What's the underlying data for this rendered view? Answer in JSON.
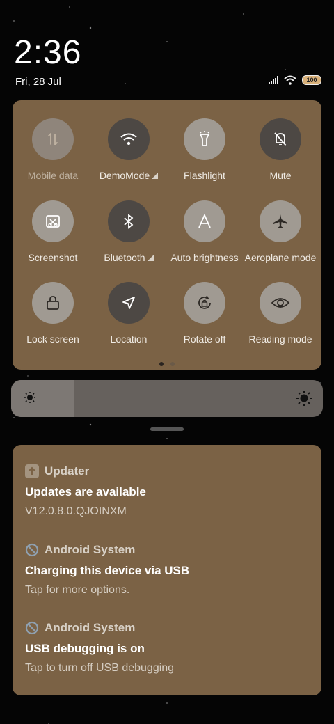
{
  "status": {
    "time": "2:36",
    "date": "Fri, 28 Jul",
    "battery": "100"
  },
  "quick_settings": {
    "tiles": [
      {
        "label": "Mobile data",
        "icon": "mobile-data-icon",
        "state": "off"
      },
      {
        "label": "DemoMode",
        "icon": "wifi-icon",
        "state": "on"
      },
      {
        "label": "Flashlight",
        "icon": "flashlight-icon",
        "state": "off"
      },
      {
        "label": "Mute",
        "icon": "mute-bell-icon",
        "state": "on"
      },
      {
        "label": "Screenshot",
        "icon": "screenshot-icon",
        "state": "off"
      },
      {
        "label": "Bluetooth",
        "icon": "bluetooth-icon",
        "state": "on"
      },
      {
        "label": "Auto brightness",
        "icon": "auto-brightness-icon",
        "state": "off"
      },
      {
        "label": "Aeroplane mode",
        "icon": "airplane-icon",
        "state": "off"
      },
      {
        "label": "Lock screen",
        "icon": "lock-icon",
        "state": "off"
      },
      {
        "label": "Location",
        "icon": "location-icon",
        "state": "on"
      },
      {
        "label": "Rotate off",
        "icon": "rotate-lock-icon",
        "state": "off"
      },
      {
        "label": "Reading mode",
        "icon": "eye-icon",
        "state": "off"
      }
    ],
    "page_count": 2,
    "current_page": 1
  },
  "brightness": {
    "level": 0.2
  },
  "notifications": [
    {
      "app": "Updater",
      "title": "Updates are available",
      "text": "V12.0.8.0.QJOINXM"
    },
    {
      "app": "Android System",
      "title": "Charging this device via USB",
      "text": "Tap for more options."
    },
    {
      "app": "Android System",
      "title": "USB debugging is on",
      "text": "Tap to turn off USB debugging"
    }
  ],
  "colors": {
    "panel": "#7b6245",
    "tile_on": "#4d4844",
    "tile_off": "#a09a92"
  }
}
